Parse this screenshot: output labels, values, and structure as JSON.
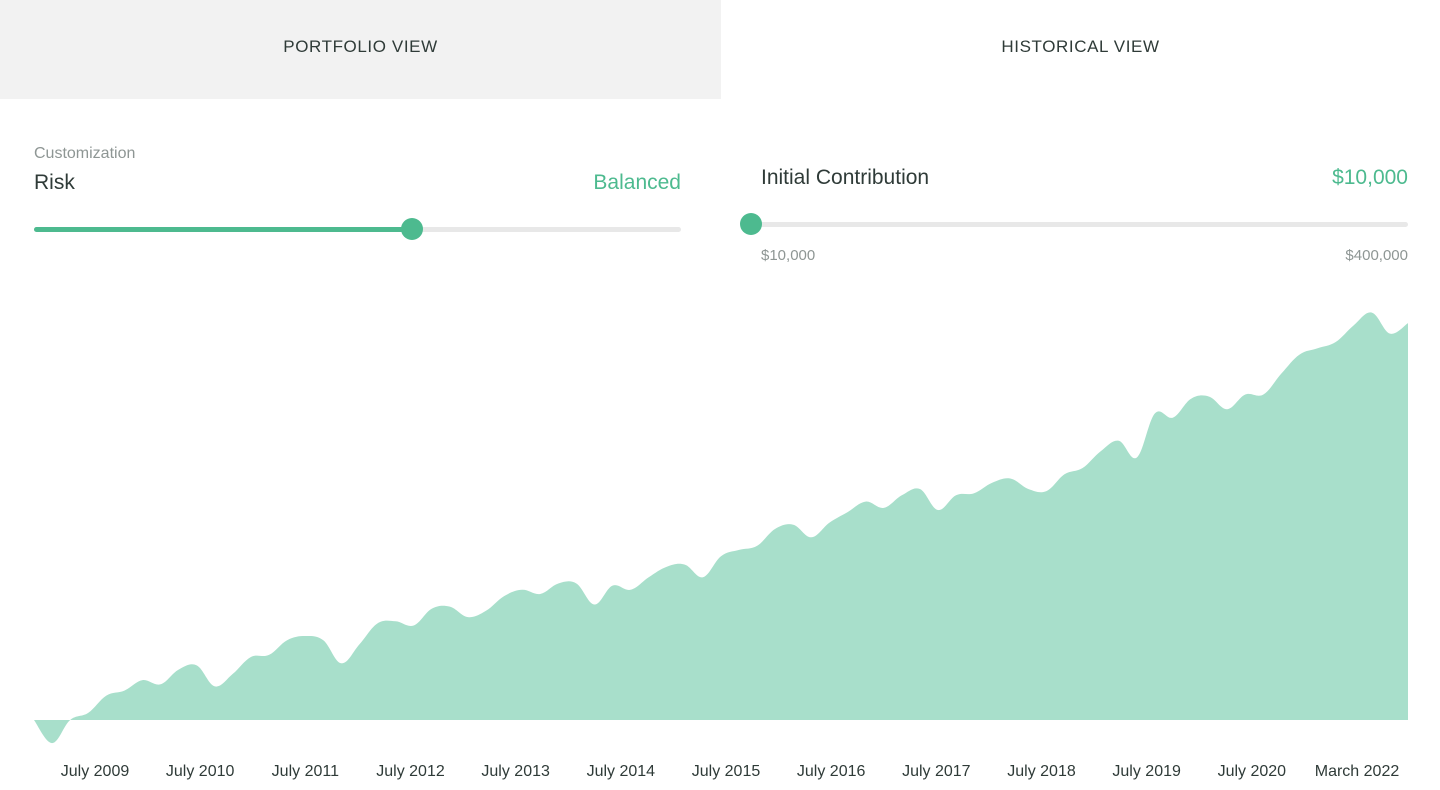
{
  "tabs": {
    "portfolio": "PORTFOLIO VIEW",
    "historical": "HISTORICAL VIEW"
  },
  "risk": {
    "caption": "Customization",
    "label": "Risk",
    "value": "Balanced",
    "slider_position": 0.585
  },
  "contribution": {
    "label": "Initial Contribution",
    "value": "$10,000",
    "min_label": "$10,000",
    "max_label": "$400,000",
    "slider_position": 0.0
  },
  "colors": {
    "accent": "#4dba8f",
    "area_fill": "#a8dfcb",
    "track": "#e8e8e8",
    "inactive_tab": "#f2f2f2"
  },
  "chart_data": {
    "type": "area",
    "xlabel": "",
    "ylabel": "",
    "grid": false,
    "x_ticks": [
      "July 2009",
      "July 2010",
      "July 2011",
      "July 2012",
      "July 2013",
      "July 2014",
      "July 2015",
      "July 2016",
      "July 2017",
      "July 2018",
      "July 2019",
      "July 2020",
      "March 2022"
    ],
    "ylim": [
      -0.06,
      1.0
    ],
    "series": [
      {
        "values": [
          0,
          -0.055,
          0,
          0.017,
          0.058,
          0.07,
          0.095,
          0.085,
          0.12,
          0.13,
          0.08,
          0.11,
          0.15,
          0.155,
          0.19,
          0.2,
          0.19,
          0.135,
          0.18,
          0.23,
          0.235,
          0.225,
          0.265,
          0.27,
          0.245,
          0.26,
          0.295,
          0.31,
          0.3,
          0.325,
          0.325,
          0.275,
          0.32,
          0.31,
          0.34,
          0.365,
          0.37,
          0.34,
          0.39,
          0.405,
          0.415,
          0.455,
          0.465,
          0.435,
          0.47,
          0.495,
          0.52,
          0.505,
          0.535,
          0.55,
          0.5,
          0.535,
          0.54,
          0.565,
          0.575,
          0.55,
          0.545,
          0.585,
          0.6,
          0.64,
          0.665,
          0.625,
          0.73,
          0.72,
          0.765,
          0.77,
          0.74,
          0.775,
          0.775,
          0.825,
          0.87,
          0.885,
          0.9,
          0.94,
          0.97,
          0.92,
          0.945
        ]
      }
    ]
  }
}
